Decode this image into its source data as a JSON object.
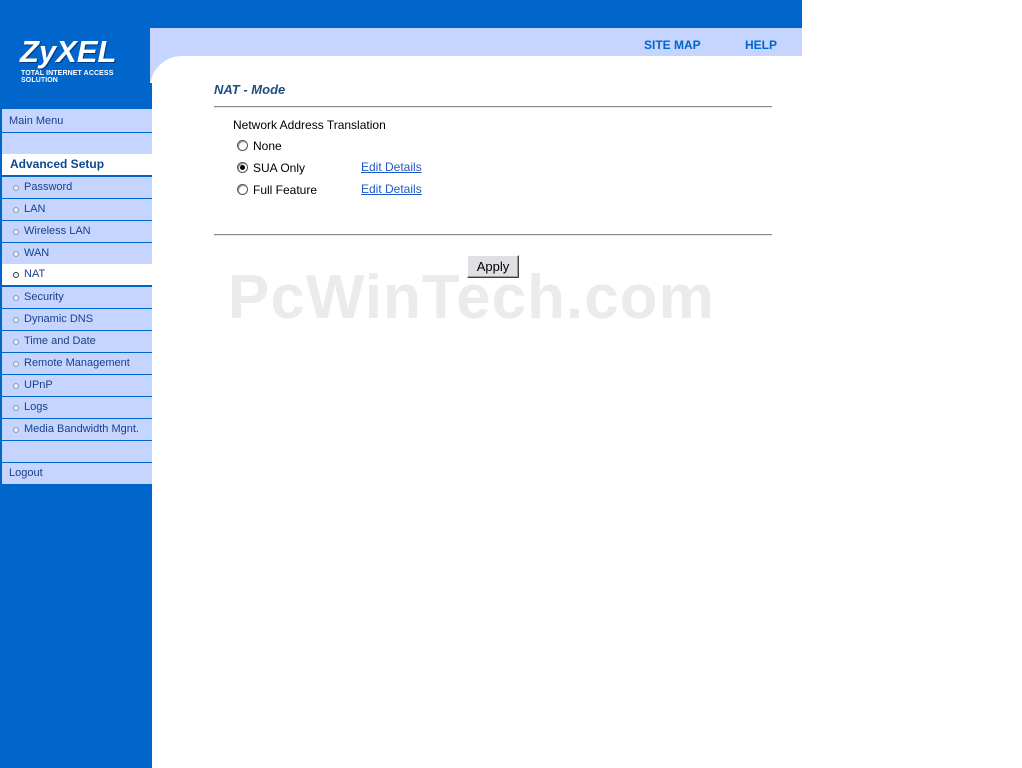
{
  "header": {
    "logo_text": "ZyXEL",
    "logo_tagline": "Total Internet Access Solution",
    "site_map_label": "SITE MAP",
    "help_label": "HELP"
  },
  "sidebar": {
    "main_menu": "Main Menu",
    "section_heading": "Advanced Setup",
    "items": [
      {
        "label": "Password"
      },
      {
        "label": "LAN"
      },
      {
        "label": "Wireless LAN"
      },
      {
        "label": "WAN"
      },
      {
        "label": "NAT",
        "active": true
      },
      {
        "label": "Security"
      },
      {
        "label": "Dynamic DNS"
      },
      {
        "label": "Time and Date"
      },
      {
        "label": "Remote Management"
      },
      {
        "label": "UPnP"
      },
      {
        "label": "Logs"
      },
      {
        "label": "Media Bandwidth Mgnt."
      }
    ],
    "logout": "Logout"
  },
  "main": {
    "title": "NAT - Mode",
    "section_label": "Network Address Translation",
    "options": [
      {
        "label": "None",
        "checked": false,
        "link": ""
      },
      {
        "label": "SUA Only",
        "checked": true,
        "link": "Edit Details"
      },
      {
        "label": "Full Feature",
        "checked": false,
        "link": "Edit Details"
      }
    ],
    "apply_label": "Apply"
  },
  "watermark": "PcWinTech.com",
  "colors": {
    "brand_blue": "#0066cc",
    "menu_light": "#c5d5ff",
    "title_color": "#1d4f82",
    "link_color": "#1e58c8"
  }
}
